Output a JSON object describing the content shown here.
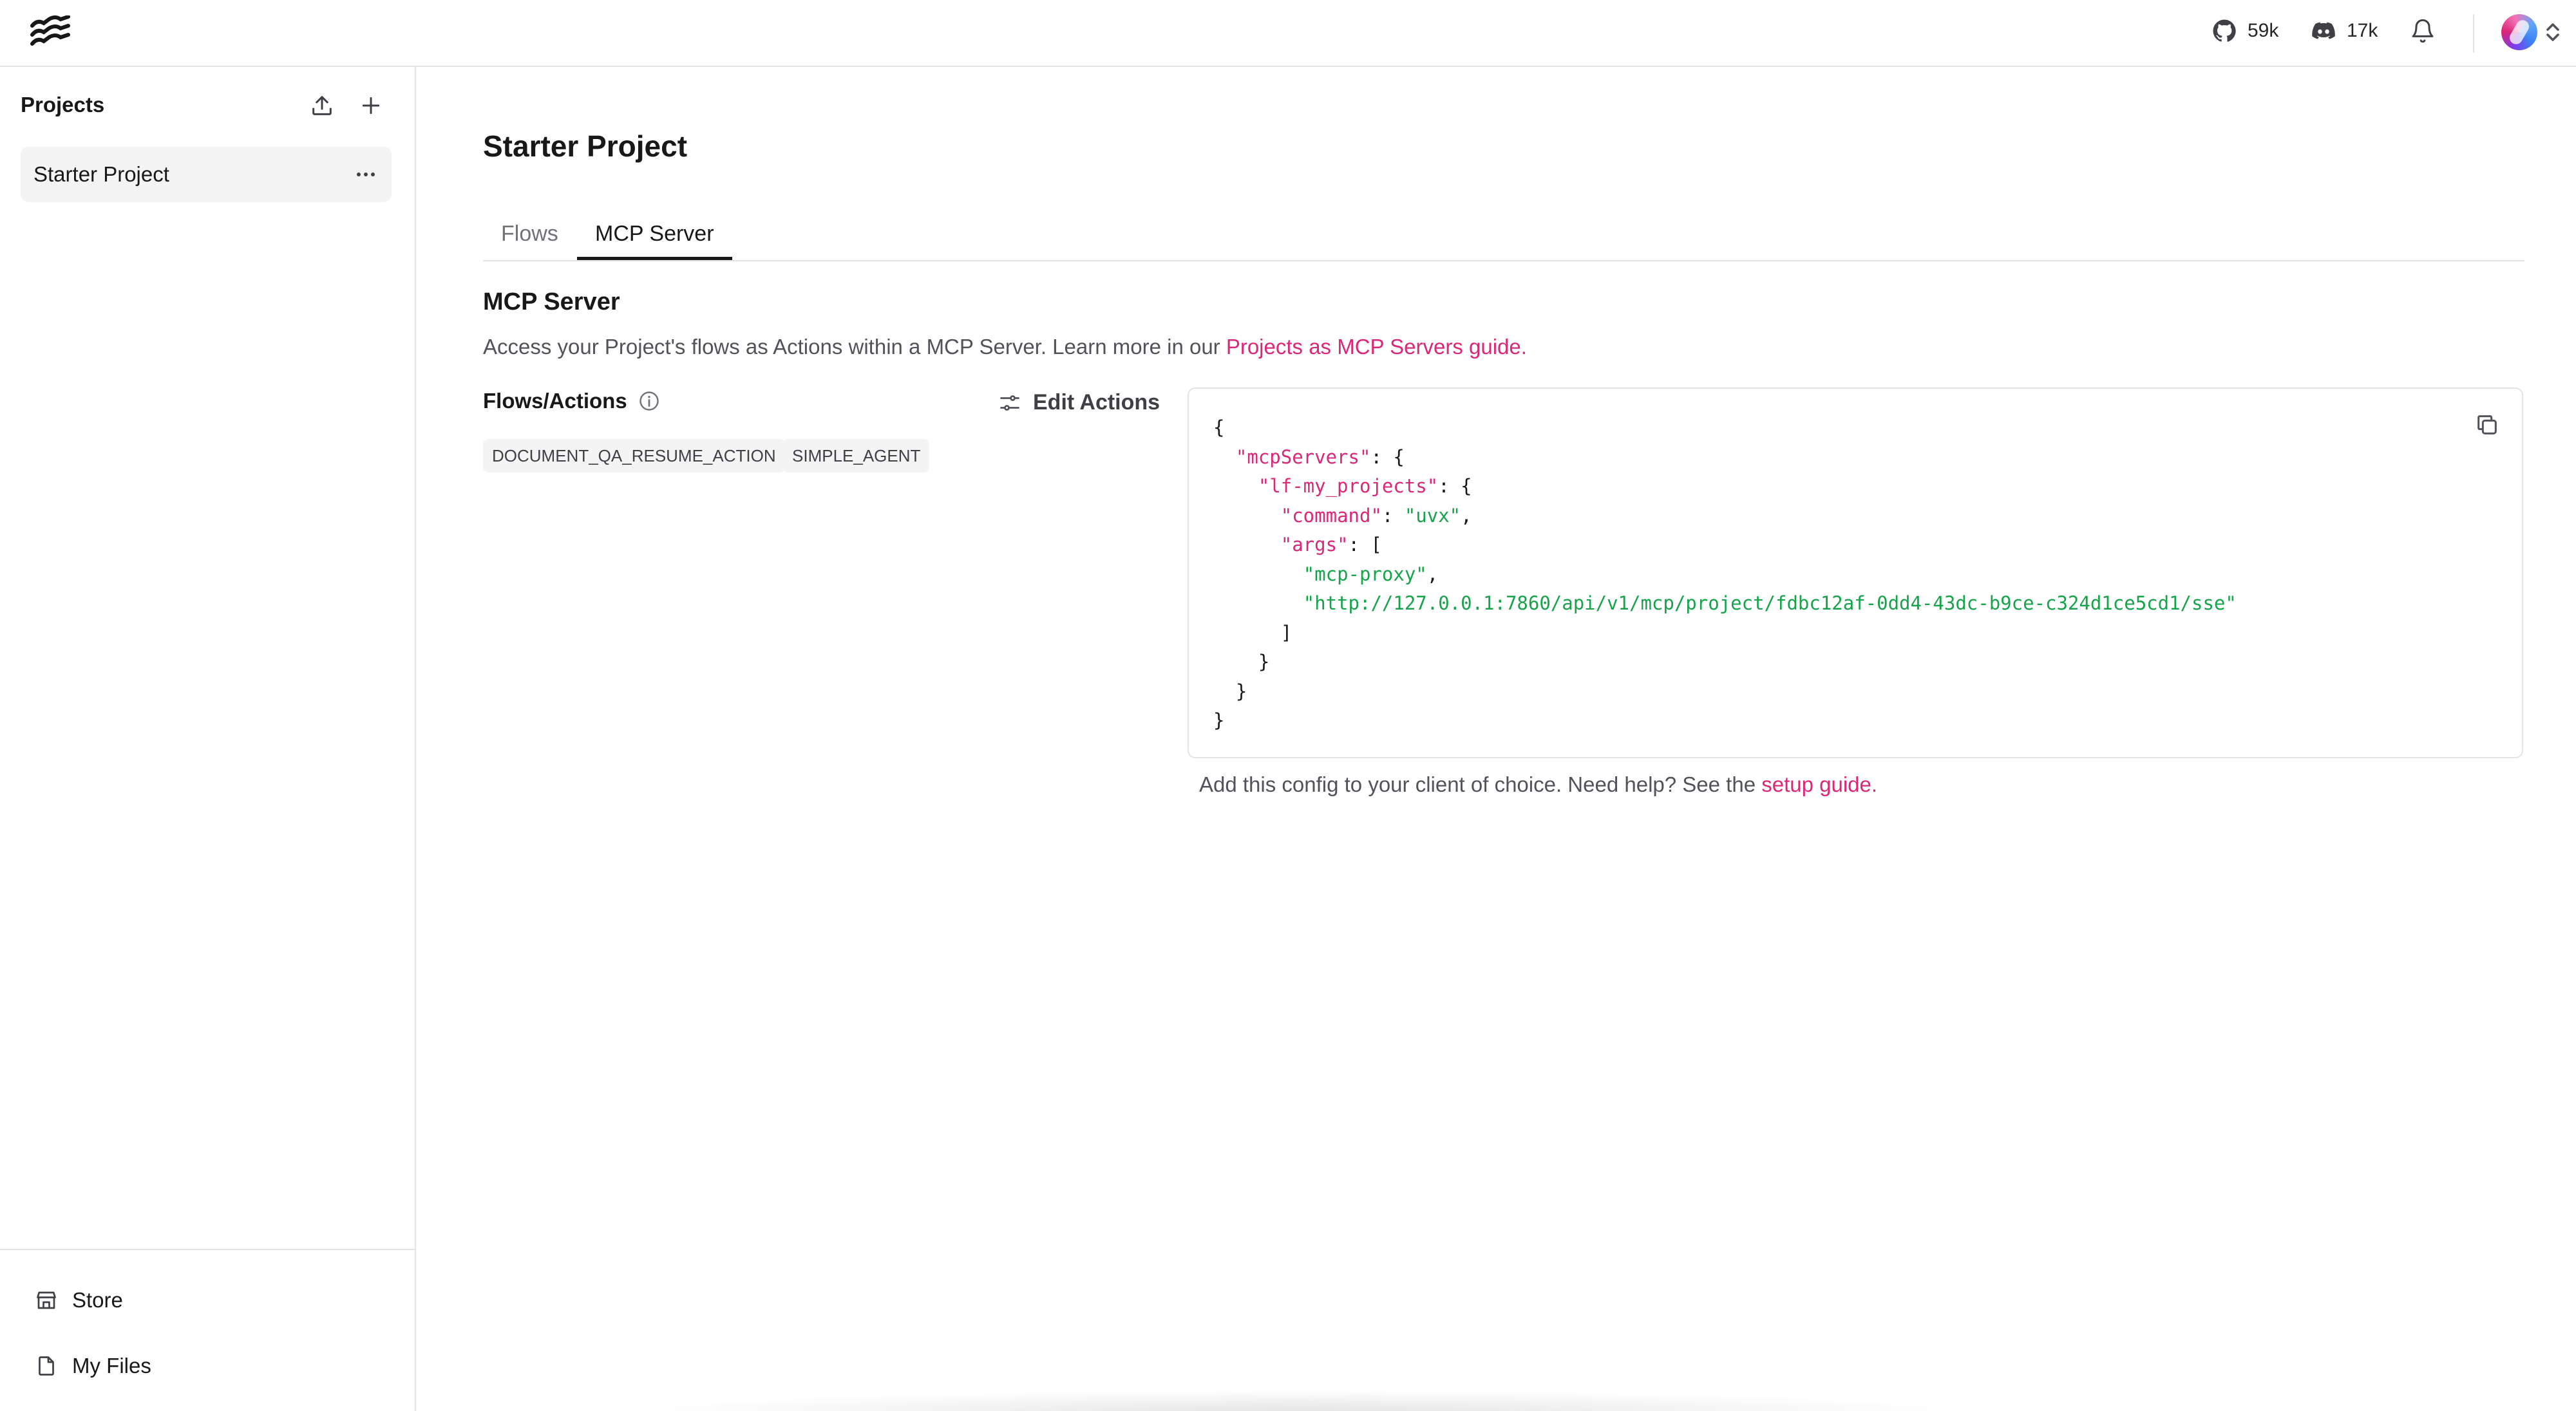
{
  "header": {
    "github_count": "59k",
    "discord_count": "17k"
  },
  "sidebar": {
    "title": "Projects",
    "projects": [
      {
        "label": "Starter Project"
      }
    ],
    "footer": {
      "store_label": "Store",
      "files_label": "My Files"
    }
  },
  "main": {
    "title": "Starter Project",
    "tabs": [
      {
        "label": "Flows",
        "active": false
      },
      {
        "label": "MCP Server",
        "active": true
      }
    ],
    "section_title": "MCP Server",
    "description": "Access your Project's flows as Actions within a MCP Server. Learn more in our ",
    "description_link": "Projects as MCP Servers guide.",
    "flows_actions_label": "Flows/Actions",
    "edit_actions_label": "Edit Actions",
    "actions": [
      "DOCUMENT_QA_RESUME_ACTION",
      "SIMPLE_AGENT"
    ],
    "config": {
      "mcpServers_key": "\"mcpServers\"",
      "server_key": "\"lf-my_projects\"",
      "command_key": "\"command\"",
      "command_value": "\"uvx\"",
      "args_key": "\"args\"",
      "arg1": "\"mcp-proxy\"",
      "arg2": "\"http://127.0.0.1:7860/api/v1/mcp/project/fdbc12af-0dd4-43dc-b9ce-c324d1ce5cd1/sse\""
    },
    "footer_note": "Add this config to your client of choice. Need help? See the ",
    "footer_link": "setup guide."
  },
  "colors": {
    "accent": "#db2777",
    "string": "#16a34a",
    "border": "#e4e4e7"
  }
}
